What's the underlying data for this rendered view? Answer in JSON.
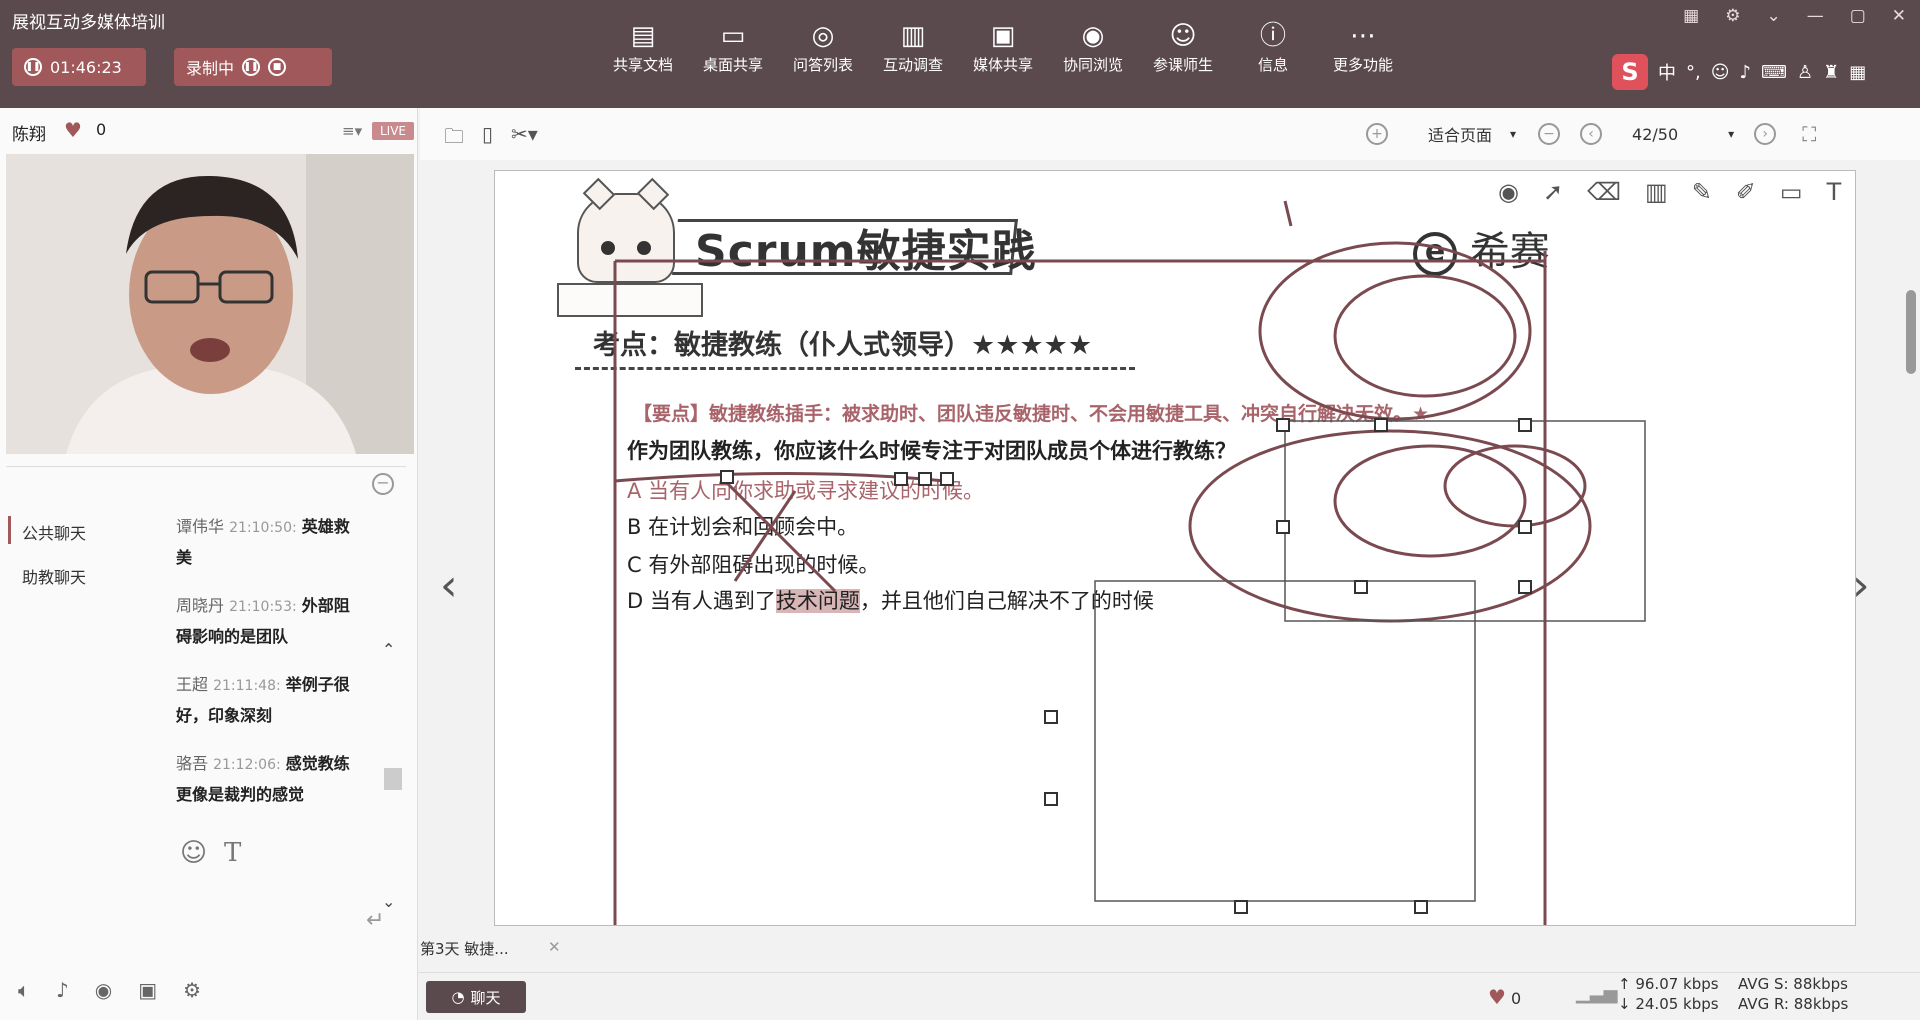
{
  "app": {
    "title": "展视互动多媒体培训"
  },
  "header": {
    "timer": "01:46:23",
    "record_label": "录制中",
    "tools": [
      {
        "label": "共享文档",
        "icon": "share-doc-icon"
      },
      {
        "label": "桌面共享",
        "icon": "desktop-share-icon"
      },
      {
        "label": "问答列表",
        "icon": "qa-icon"
      },
      {
        "label": "互动调查",
        "icon": "survey-icon"
      },
      {
        "label": "媒体共享",
        "icon": "media-icon"
      },
      {
        "label": "协同浏览",
        "icon": "browse-icon"
      },
      {
        "label": "参课师生",
        "icon": "people-icon"
      },
      {
        "label": "信息",
        "icon": "info-icon"
      },
      {
        "label": "更多功能",
        "icon": "more-icon"
      }
    ],
    "ime": {
      "logo": "S",
      "lang": "中",
      "punct": "°,"
    }
  },
  "presenter": {
    "name": "陈翔",
    "likes": "0",
    "live": "LIVE"
  },
  "chat": {
    "tabs": [
      "公共聊天",
      "助教聊天"
    ],
    "messages": [
      {
        "user": "谭伟华",
        "time": "21:10:50:",
        "text": "英雄救美"
      },
      {
        "user": "周晓丹",
        "time": "21:10:53:",
        "text": "外部阻碍影响的是团队"
      },
      {
        "user": "王超",
        "time": "21:11:48:",
        "text": "举例子很好，印象深刻"
      },
      {
        "user": "骆吾",
        "time": "21:12:06:",
        "text": "感觉教练更像是裁判的感觉"
      }
    ]
  },
  "doc_toolbar": {
    "zoom_label": "适合页面",
    "page": "42/50"
  },
  "slide": {
    "title": "Scrum敏捷实践",
    "brand": "希赛",
    "exam_point": "考点：敏捷教练（仆人式领导）★★★★★",
    "key_point": "【要点】敏捷教练插手：被求助时、团队违反敏捷时、不会用敏捷工具、冲突自行解决无效。★",
    "question": "作为团队教练，你应该什么时候专注于对团队成员个体进行教练？",
    "options": {
      "a": "A 当有人向你求助或寻求建议的时候。",
      "b": "B 在计划会和回顾会中。",
      "c": "C 有外部阻碍出现的时候。",
      "d_pre": "D 当有人遇到了",
      "d_hl": "技术问题",
      "d_post": "，并且他们自己解决不了的时候"
    }
  },
  "doc_tab": {
    "label": "第3天 敏捷..."
  },
  "status": {
    "chat_button": "聊天",
    "likes": "0",
    "net_up": "96.07 kbps",
    "net_down": "24.05 kbps",
    "avg_s": "AVG S: 88kbps",
    "avg_r": "AVG R: 88kbps"
  },
  "colors": {
    "accent": "#a0585b",
    "topbar": "#5a4a4e",
    "highlight": "#a8646a"
  }
}
